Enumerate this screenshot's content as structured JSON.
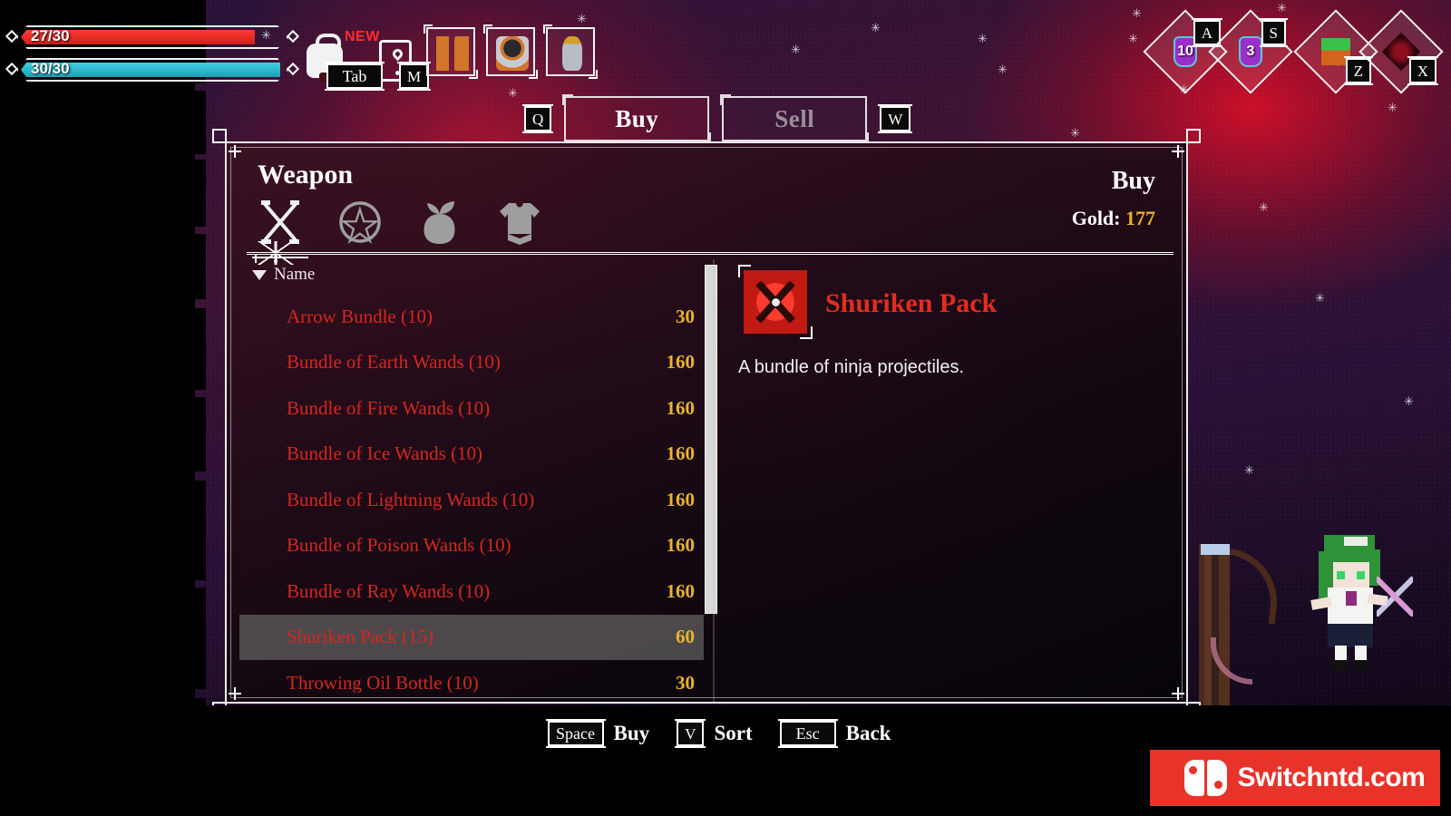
{
  "hud": {
    "health": {
      "label": "27/30",
      "current": 27,
      "max": 30,
      "color": "#ff3b34"
    },
    "mana": {
      "label": "30/30",
      "current": 30,
      "max": 30,
      "color": "#3fd0e2"
    },
    "backpack_key": "Tab",
    "map_key": "M",
    "new_badge": "NEW",
    "equip_slots": [
      {
        "name": "boots-item"
      },
      {
        "name": "armor-item"
      },
      {
        "name": "bottle-item"
      }
    ],
    "abilities": [
      {
        "key": "A",
        "count": "10",
        "icon": "potion-purple"
      },
      {
        "key": "S",
        "count": "3",
        "icon": "potion-purple"
      },
      {
        "key": "Z",
        "count": "",
        "icon": "green-weapon"
      },
      {
        "key": "X",
        "count": "",
        "icon": "dark-relic"
      }
    ]
  },
  "shop_tabs": {
    "left_key": "Q",
    "right_key": "W",
    "buy_label": "Buy",
    "sell_label": "Sell",
    "active": "Buy"
  },
  "panel": {
    "title": "Weapon",
    "mode": "Buy",
    "gold_label": "Gold:",
    "gold_value": "177",
    "gold_color": "#e8b42e",
    "categories": [
      {
        "name": "weapon",
        "icon": "crossed-swords-icon",
        "selected": true
      },
      {
        "name": "magic",
        "icon": "pentagram-icon",
        "selected": false
      },
      {
        "name": "consumable",
        "icon": "fruit-potion-icon",
        "selected": false
      },
      {
        "name": "armor",
        "icon": "tunic-icon",
        "selected": false
      }
    ],
    "sort": {
      "arrow": "▼",
      "label": "Name"
    },
    "items": [
      {
        "name": "Arrow Bundle (10)",
        "price": "30",
        "selected": false
      },
      {
        "name": "Bundle of Earth Wands (10)",
        "price": "160",
        "selected": false
      },
      {
        "name": "Bundle of Fire Wands (10)",
        "price": "160",
        "selected": false
      },
      {
        "name": "Bundle of Ice Wands (10)",
        "price": "160",
        "selected": false
      },
      {
        "name": "Bundle of Lightning Wands (10)",
        "price": "160",
        "selected": false
      },
      {
        "name": "Bundle of Poison Wands (10)",
        "price": "160",
        "selected": false
      },
      {
        "name": "Bundle of Ray Wands (10)",
        "price": "160",
        "selected": false
      },
      {
        "name": "Shuriken Pack (15)",
        "price": "60",
        "selected": true
      },
      {
        "name": "Throwing Oil Bottle (10)",
        "price": "30",
        "selected": false
      }
    ],
    "item_name_color": "#d6261f",
    "price_color": "#e8b42e",
    "detail": {
      "item_name": "Shuriken Pack",
      "description": "A bundle of ninja projectiles.",
      "icon": "shuriken-icon"
    }
  },
  "footer": {
    "hints": [
      {
        "key": "Space",
        "label": "Buy"
      },
      {
        "key": "V",
        "label": "Sort"
      },
      {
        "key": "Esc",
        "label": "Back"
      }
    ]
  },
  "watermark": {
    "text": "Switchntd.com",
    "color": "#e8332a"
  }
}
